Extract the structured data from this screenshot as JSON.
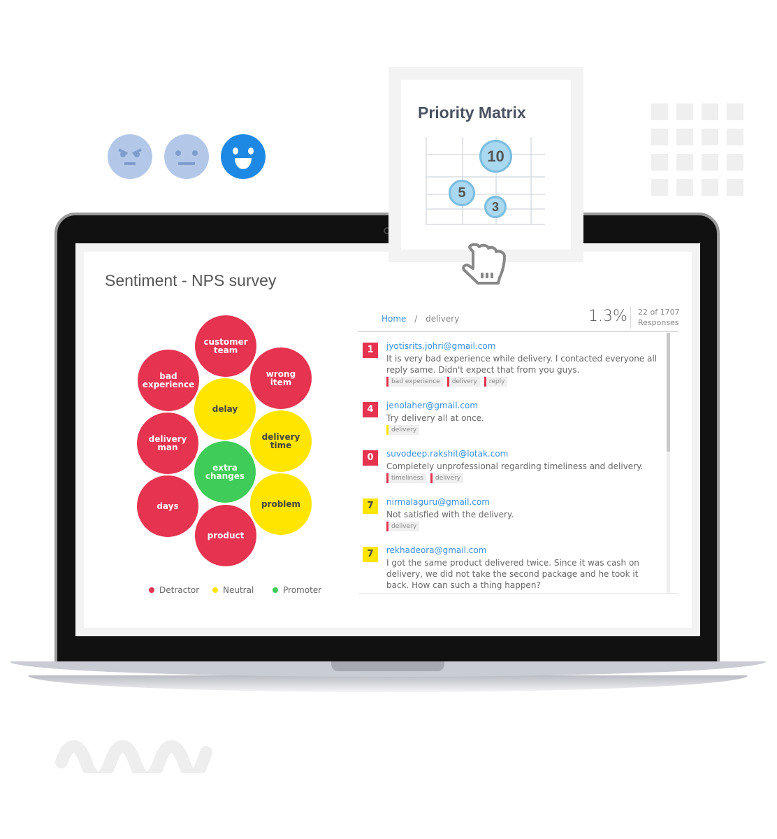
{
  "faces": [
    "angry-face-icon",
    "neutral-face-icon",
    "happy-face-icon"
  ],
  "priority_matrix": {
    "title": "Priority Matrix",
    "bubbles": [
      "10",
      "5",
      "3"
    ]
  },
  "dashboard": {
    "title": "Sentiment - NPS survey",
    "bubbles": [
      {
        "label": "customer team",
        "type": "Detractor"
      },
      {
        "label": "bad experience",
        "type": "Detractor"
      },
      {
        "label": "wrong item",
        "type": "Detractor"
      },
      {
        "label": "delay",
        "type": "Neutral"
      },
      {
        "label": "delivery man",
        "type": "Detractor"
      },
      {
        "label": "delivery time",
        "type": "Neutral"
      },
      {
        "label": "extra changes",
        "type": "Promoter"
      },
      {
        "label": "days",
        "type": "Detractor"
      },
      {
        "label": "problem",
        "type": "Neutral"
      },
      {
        "label": "product",
        "type": "Detractor"
      }
    ],
    "legend": [
      "Detractor",
      "Neutral",
      "Promoter"
    ],
    "colors": {
      "Detractor": "#e63350",
      "Neutral": "#ffe500",
      "Promoter": "#3fcc58",
      "link": "#3b8fe0"
    },
    "breadcrumb": {
      "home": "Home",
      "sep": "/",
      "current": "delivery"
    },
    "percent": "1.3%",
    "count": "22 of 1707",
    "count_label": "Responses",
    "responses": [
      {
        "score": "1",
        "type": "Detractor",
        "email": "jyotisrits.johri@gmail.com",
        "text": "It is very bad experience while delivery. I contacted everyone all reply same. Didn't expect that from you guys.",
        "tags": [
          {
            "t": "bad experience",
            "c": "r"
          },
          {
            "t": "delivery",
            "c": "r"
          },
          {
            "t": "reply",
            "c": "r"
          }
        ]
      },
      {
        "score": "4",
        "type": "Detractor",
        "email": "jenolaher@gmail.com",
        "text": "Try delivery all at once.",
        "tags": [
          {
            "t": "delivery",
            "c": "y"
          }
        ]
      },
      {
        "score": "0",
        "type": "Detractor",
        "email": "suvodeep.rakshit@lotak.com",
        "text": "Completely unprofessional regarding timeliness and delivery.",
        "tags": [
          {
            "t": "timeliness",
            "c": "r"
          },
          {
            "t": "delivery",
            "c": "r"
          }
        ]
      },
      {
        "score": "7",
        "type": "Neutral",
        "email": "nirmalaguru@gmail.com",
        "text": "Not satisfied with the delivery.",
        "tags": [
          {
            "t": "delivery",
            "c": "r"
          }
        ]
      },
      {
        "score": "7",
        "type": "Neutral",
        "email": "rekhadeora@gmail.com",
        "text": "I got the same product delivered twice. Since it was cash on delivery, we did not take the second package and he took it back. How can such a thing happen?",
        "tags": []
      }
    ]
  }
}
